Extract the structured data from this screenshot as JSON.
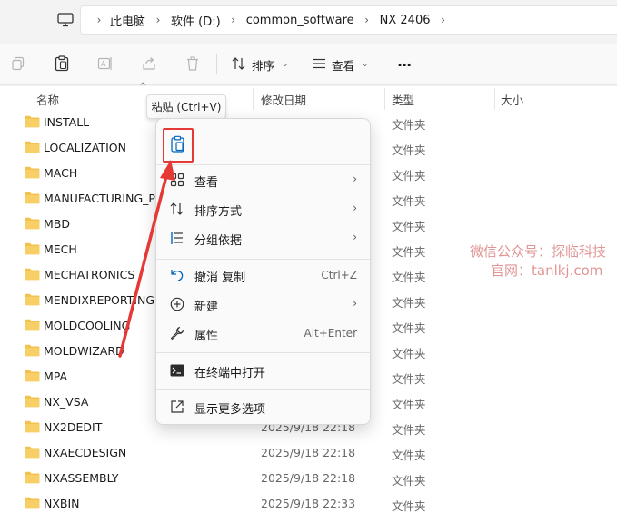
{
  "address": {
    "crumbs": [
      "此电脑",
      "软件 (D:)",
      "common_software",
      "NX 2406"
    ]
  },
  "toolbar": {
    "sort_label": "排序",
    "view_label": "查看",
    "more_label": "···"
  },
  "columns": {
    "name": "名称",
    "date": "修改日期",
    "type": "类型",
    "size": "大小"
  },
  "files": [
    {
      "name": "INSTALL",
      "date": "",
      "type": "文件夹"
    },
    {
      "name": "LOCALIZATION",
      "date": "",
      "type": "文件夹"
    },
    {
      "name": "MACH",
      "date": "",
      "type": "文件夹"
    },
    {
      "name": "MANUFACTURING_PI",
      "date": "",
      "type": "文件夹"
    },
    {
      "name": "MBD",
      "date": "",
      "type": "文件夹"
    },
    {
      "name": "MECH",
      "date": "",
      "type": "文件夹"
    },
    {
      "name": "MECHATRONICS",
      "date": "",
      "type": "文件夹"
    },
    {
      "name": "MENDIXREPORTING",
      "date": "",
      "type": "文件夹"
    },
    {
      "name": "MOLDCOOLING",
      "date": "",
      "type": "文件夹"
    },
    {
      "name": "MOLDWIZARD",
      "date": "",
      "type": "文件夹"
    },
    {
      "name": "MPA",
      "date": "",
      "type": "文件夹"
    },
    {
      "name": "NX_VSA",
      "date": "",
      "type": "文件夹"
    },
    {
      "name": "NX2DEDIT",
      "date": "2025/9/18 22:18",
      "type": "文件夹"
    },
    {
      "name": "NXAECDESIGN",
      "date": "2025/9/18 22:18",
      "type": "文件夹"
    },
    {
      "name": "NXASSEMBLY",
      "date": "2025/9/18 22:18",
      "type": "文件夹"
    },
    {
      "name": "NXBIN",
      "date": "2025/9/18 22:33",
      "type": "文件夹"
    }
  ],
  "tooltip": "粘贴 (Ctrl+V)",
  "menu": {
    "items": [
      {
        "label": "查看",
        "shortcut": "",
        "arrow": "›"
      },
      {
        "label": "排序方式",
        "shortcut": "",
        "arrow": "›"
      },
      {
        "label": "分组依据",
        "shortcut": "",
        "arrow": "›"
      },
      {
        "label": "撤消 复制",
        "shortcut": "Ctrl+Z",
        "arrow": ""
      },
      {
        "label": "新建",
        "shortcut": "",
        "arrow": "›"
      },
      {
        "label": "属性",
        "shortcut": "Alt+Enter",
        "arrow": ""
      },
      {
        "label": "在终端中打开",
        "shortcut": "",
        "arrow": ""
      },
      {
        "label": "显示更多选项",
        "shortcut": "",
        "arrow": ""
      }
    ]
  },
  "watermark": {
    "line1": "微信公众号：探临科技",
    "line2": "官网：tanlkj.com"
  },
  "colors": {
    "folder": "#f2c14e",
    "highlight": "#e53935",
    "accent": "#0067c0"
  }
}
